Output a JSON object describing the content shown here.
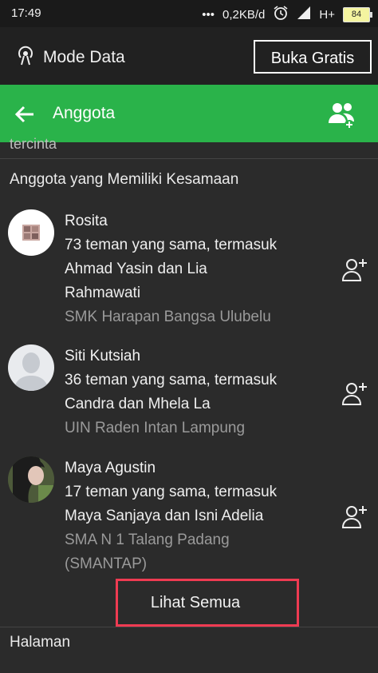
{
  "status_bar": {
    "time": "17:49",
    "dots": "•••",
    "speed": "0,2KB/d",
    "network": "H+",
    "battery": "84"
  },
  "mode_bar": {
    "label": "Mode Data",
    "button": "Buka Gratis"
  },
  "header": {
    "title": "Anggota"
  },
  "snippet": "tercinta",
  "section": {
    "title": "Anggota yang Memiliki Kesamaan"
  },
  "members": [
    {
      "name": "Rosita",
      "desc": [
        "73 teman yang sama, termasuk",
        "Ahmad Yasin dan Lia",
        "Rahmawati"
      ],
      "school": [
        "SMK Harapan Bangsa Ulubelu"
      ]
    },
    {
      "name": "Siti Kutsiah",
      "desc": [
        "36 teman yang sama, termasuk",
        "Candra dan Mhela La"
      ],
      "school": [
        "UIN Raden Intan Lampung"
      ]
    },
    {
      "name": "Maya Agustin",
      "desc": [
        "17 teman yang sama, termasuk",
        "Maya Sanjaya dan Isni Adelia"
      ],
      "school": [
        "SMA N 1 Talang Padang",
        "(SMANTAP)"
      ]
    }
  ],
  "see_all": "Lihat Semua",
  "pages": {
    "title": "Halaman"
  },
  "colors": {
    "accent": "#2ab34a",
    "highlight": "#ef3b52",
    "background": "#2b2b2b"
  }
}
